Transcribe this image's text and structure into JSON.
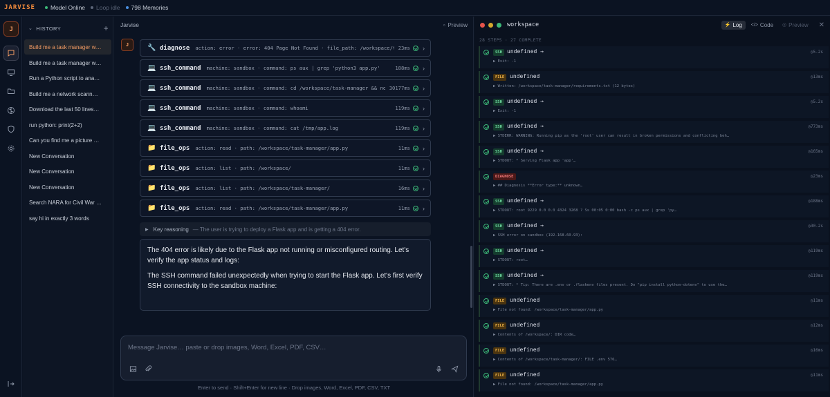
{
  "topbar": {
    "brand": "JARVISE",
    "status_model": "Model Online",
    "status_loop": "Loop idle",
    "status_memories": "798 Memories",
    "colors": {
      "online": "#3cb878",
      "idle": "#5b6578",
      "memories": "#4a90e2"
    }
  },
  "rail": {
    "avatar": "J",
    "icons": [
      "chat-icon",
      "monitor-icon",
      "folder-icon",
      "brain-icon",
      "shield-icon",
      "gear-icon",
      "logout-icon"
    ]
  },
  "history": {
    "title": "HISTORY",
    "items": [
      "Build me a task manager w…",
      "Build me a task manager w…",
      "Run a Python script to ana…",
      "Build me a network scann…",
      "Download the last 50 lines…",
      "run python: print(2+2)",
      "Can you find me a picture …",
      "New Conversation",
      "New Conversation",
      "New Conversation",
      "Search NARA for Civil War …",
      "say hi in exactly 3 words"
    ]
  },
  "chat": {
    "title": "Jarvise",
    "preview_label": "Preview",
    "avatar": "J",
    "tools": [
      {
        "icon": "wrench-icon",
        "glyph": "🔧",
        "name": "diagnose",
        "args": "action: error · error: 404 Page Not Found · file_path: /workspace/task-manager/app.py",
        "duration": "23ms"
      },
      {
        "icon": "computer-icon",
        "glyph": "💻",
        "name": "ssh_command",
        "args": "machine: sandbox · command: ps aux | grep 'python3 app.py'",
        "duration": "188ms"
      },
      {
        "icon": "computer-icon",
        "glyph": "💻",
        "name": "ssh_command",
        "args": "machine: sandbox · command: cd /workspace/task-manager && nohup python3 app.py",
        "duration": "30177ms"
      },
      {
        "icon": "computer-icon",
        "glyph": "💻",
        "name": "ssh_command",
        "args": "machine: sandbox · command: whoami",
        "duration": "119ms"
      },
      {
        "icon": "computer-icon",
        "glyph": "💻",
        "name": "ssh_command",
        "args": "machine: sandbox · command: cat /tmp/app.log",
        "duration": "119ms"
      },
      {
        "icon": "folder-icon",
        "glyph": "📁",
        "name": "file_ops",
        "args": "action: read · path: /workspace/task-manager/app.py",
        "duration": "11ms"
      },
      {
        "icon": "folder-icon",
        "glyph": "📁",
        "name": "file_ops",
        "args": "action: list · path: /workspace/",
        "duration": "11ms"
      },
      {
        "icon": "folder-icon",
        "glyph": "📁",
        "name": "file_ops",
        "args": "action: list · path: /workspace/task-manager/",
        "duration": "16ms"
      },
      {
        "icon": "folder-icon",
        "glyph": "📁",
        "name": "file_ops",
        "args": "action: read · path: /workspace/task-manager/app.py",
        "duration": "11ms"
      }
    ],
    "reasoning_label": "Key reasoning",
    "reasoning_text": "— The user is trying to deploy a Flask app and is getting a 404 error.",
    "answer_p1": "The 404 error is likely due to the Flask app not running or misconfigured routing. Let's verify the app status and logs:",
    "answer_p2": "The SSH command failed unexpectedly when trying to start the Flask app. Let's first verify SSH connectivity to the sandbox machine:",
    "composer_placeholder": "Message Jarvise… paste or drop images, Word, Excel, PDF, CSV…",
    "hint": "Enter to send · Shift+Enter for new line · Drop images, Word, Excel, PDF, CSV, TXT"
  },
  "workspace": {
    "title": "workspace",
    "tabs": {
      "log": "Log",
      "code": "Code",
      "preview": "Preview"
    },
    "steps_label": "28 STEPS · 27 COMPLETE",
    "entries": [
      {
        "type": "SSH",
        "kind": "ssh",
        "title": "undefined →",
        "time": "5.2s",
        "output": "▶ Exit: -1"
      },
      {
        "type": "FILE",
        "kind": "file",
        "title": "undefined",
        "time": "13ms",
        "output": "▶ Written: /workspace/task-manager/requirements.txt (12 bytes)"
      },
      {
        "type": "SSH",
        "kind": "ssh",
        "title": "undefined →",
        "time": "5.2s",
        "output": "▶ Exit: -1"
      },
      {
        "type": "SSH",
        "kind": "ssh",
        "title": "undefined →",
        "time": "773ms",
        "output": "▶ STDERR: WARNING: Running pip as the 'root' user can result in broken permissions and conflicting beh…"
      },
      {
        "type": "SSH",
        "kind": "ssh",
        "title": "undefined →",
        "time": "165ms",
        "output": "▶ STDOUT: * Serving Flask app 'app'…"
      },
      {
        "type": "DIAGNOSE",
        "kind": "diag",
        "title": "",
        "time": "23ms",
        "output": "▶ ## Diagnosis **Error type:** unknown…"
      },
      {
        "type": "SSH",
        "kind": "ssh",
        "title": "undefined →",
        "time": "188ms",
        "output": "▶ STDOUT: root 9229 0.0 0.0 4324 3268 ? Ss 00:05 0:00 bash -c ps aux | grep 'py…"
      },
      {
        "type": "SSH",
        "kind": "ssh",
        "title": "undefined →",
        "time": "30.2s",
        "output": "▶ SSH error on sandbox (192.168.60.93):"
      },
      {
        "type": "SSH",
        "kind": "ssh",
        "title": "undefined →",
        "time": "119ms",
        "output": "▶ STDOUT: root…"
      },
      {
        "type": "SSH",
        "kind": "ssh",
        "title": "undefined →",
        "time": "119ms",
        "output": "▶ STDOUT: * Tip: There are .env or .flaskenv files present. Do \"pip install python-dotenv\" to use the…"
      },
      {
        "type": "FILE",
        "kind": "file",
        "title": "undefined",
        "time": "11ms",
        "output": "▶ File not found: /workspace/task-manager/app.py"
      },
      {
        "type": "FILE",
        "kind": "file",
        "title": "undefined",
        "time": "12ms",
        "output": "▶ Contents of /workspace/: DIR code…"
      },
      {
        "type": "FILE",
        "kind": "file",
        "title": "undefined",
        "time": "16ms",
        "output": "▶ Contents of /workspace/task-manager/: FILE .env 576…"
      },
      {
        "type": "FILE",
        "kind": "file",
        "title": "undefined",
        "time": "11ms",
        "output": "▶ File not found: /workspace/task-manager/app.py"
      }
    ]
  }
}
